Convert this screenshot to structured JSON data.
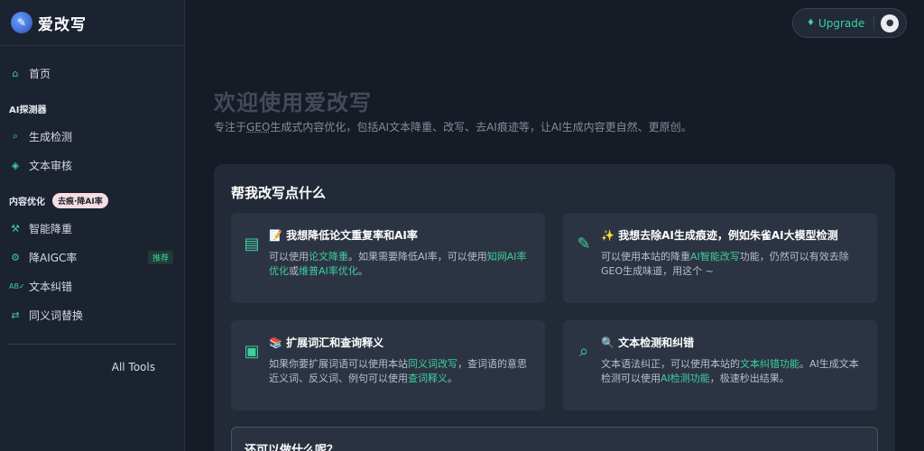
{
  "brand": {
    "title": "爱改写"
  },
  "sidebar": {
    "home": "首页",
    "section1": "AI探测器",
    "detect": "生成检测",
    "review": "文本审核",
    "section2": "内容优化",
    "section2_tag": "去痕·降AI率",
    "smart_reduce": "智能降重",
    "reduce_aigc": "降AIGC率",
    "reduce_aigc_badge": "推荐",
    "correct": "文本纠错",
    "synonym": "同义词替换",
    "all_tools": "All Tools"
  },
  "topbar": {
    "upgrade": "Upgrade"
  },
  "hero": {
    "title": "欢迎使用爱改写",
    "sub_prefix": "专注于",
    "sub_geo": "GEO",
    "sub_rest": "生成式内容优化，包括AI文本降重、改写、去AI痕迹等，让AI生成内容更自然、更原创。"
  },
  "panel": {
    "title": "帮我改写点什么",
    "cards": [
      {
        "icon": "document-icon",
        "title": "📝 我想降低论文重复率和AI率",
        "p1": "可以使用",
        "l1": "论文降重",
        "p2": "。如果需要降低AI率，可以使用",
        "l2": "知网AI率优化",
        "p3": "或",
        "l3": "维普AI率优化",
        "p4": "。"
      },
      {
        "icon": "pencil-icon",
        "title": "✨ 我想去除AI生成痕迹，例如朱雀AI大模型检测",
        "p1": "可以使用本站的降重",
        "l1": "AI智能改写",
        "p2": "功能，仍然可以有效去除GEO生成味道，用这个 ~"
      },
      {
        "icon": "book-icon",
        "title": "📚 扩展词汇和查询释义",
        "p1": "如果你要扩展词语可以使用本站",
        "l1": "同义词改写",
        "p2": "，查词语的意思近义词、反义词、例句可以使用",
        "l2": "查词释义",
        "p3": "。"
      },
      {
        "icon": "search-icon",
        "title": "🔍 文本检测和纠错",
        "p1": "文本语法纠正，可以使用本站的",
        "l1": "文本纠错功能",
        "p2": "。AI生成文本检测可以使用",
        "l2": "AI检测功能",
        "p3": "，极速秒出结果。"
      }
    ],
    "more_title": "还可以做什么呢？"
  },
  "colors": {
    "accent": "#3ecf9c",
    "background": "#161b26",
    "panel": "#222a38",
    "card": "#2c3443"
  }
}
